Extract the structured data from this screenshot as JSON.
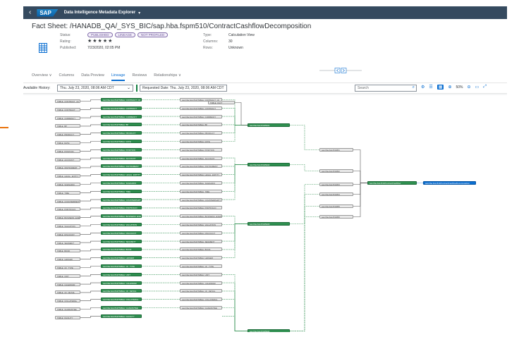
{
  "shell": {
    "back": "‹",
    "logo": "SAP",
    "title": "Data Intelligence Metadata Explorer",
    "caret": "▾"
  },
  "header": {
    "fact_title": "Fact Sheet: /HANADB_QA/_SYS_BIC/sap.hba.fspm510/ContractCashflowDecomposition",
    "status_label": "Status:",
    "badges": [
      "PUBLISHED",
      "LINEAGE",
      "NOT PROFILED"
    ],
    "rating_label": "Rating:",
    "stars": "★★★★★",
    "published_label": "Published:",
    "published_value": "7/23/2020, 02:05 PM",
    "type_label": "Type:",
    "type_value": "Calculation View",
    "columns_label": "Columns:",
    "columns_value": "30",
    "rows_label": "Rows:",
    "rows_value": "Unknown"
  },
  "tabs": [
    "Overview ∨",
    "Columns",
    "Data Preview",
    "Lineage",
    "Reviews",
    "Relationships ∨"
  ],
  "active_tab": "Lineage",
  "toolbar": {
    "history_label": "Available History:",
    "history_value": "Thu. July 23, 2020, 08:06 AM CDT",
    "requested": "Requested Date: Thu. July 23, 2020, 08:06 AM CDT",
    "search_placeholder": "Search",
    "zoom": "50%"
  },
  "lineage": {
    "final_node": "sap.hba.fspm510/ContractCashflowDecomposition",
    "sources_left": [
      "TABLE_CONTRACT_CF",
      "TABLE_CONTRACT",
      "TABLE_CURRENCY",
      "TABLE_BP",
      "TABLE_PRODUCT",
      "TABLE_RATE",
      "TABLE_POSITION",
      "TABLE_ACCOUNT",
      "TABLE_INSTRUMENT",
      "TABLE_LEGAL_ENTITY",
      "TABLE_SCENARIO",
      "TABLE_TIME",
      "TABLE_COUNTERPARTY",
      "TABLE_PORTFOLIO",
      "TABLE_BUSINESS_EVENT",
      "TABLE_VALUATION",
      "TABLE_DISCOUNT",
      "TABLE_SEGMENT",
      "TABLE_BOOK",
      "TABLE_LEDGER",
      "TABLE_CF_TYPE",
      "TABLE_UNIT",
      "TABLE_CALENDAR",
      "TABLE_CF_DETAIL",
      "TABLE_COLLATERAL",
      "TABLE_GUARANTEE",
      "TABLE_FACILITY"
    ]
  },
  "colors": {
    "shell": "#354a5f",
    "accent": "#0a6ed1",
    "green": "#2e8f4f"
  }
}
